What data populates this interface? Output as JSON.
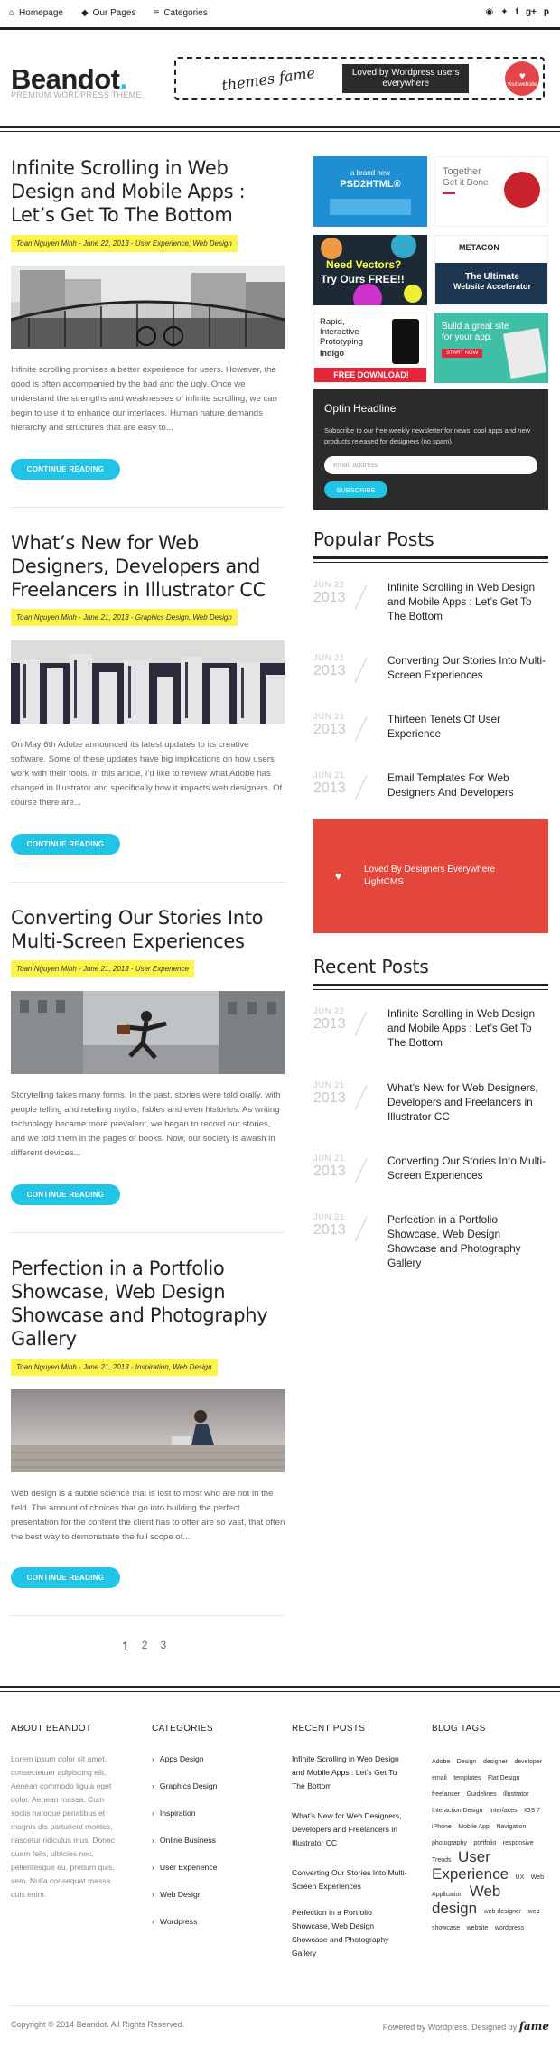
{
  "topnav": {
    "items": [
      {
        "label": "Homepage",
        "icon": "home-icon"
      },
      {
        "label": "Our Pages",
        "icon": "tag-icon"
      },
      {
        "label": "Categories",
        "icon": "menu-icon"
      }
    ],
    "social": [
      "rss-icon",
      "twitter-icon",
      "facebook-icon",
      "google-plus-icon",
      "pinterest-icon"
    ]
  },
  "site": {
    "name": "Beandot",
    "dot": ".",
    "tagline": "PREMIUM WORDPRESS THEME"
  },
  "banner": {
    "script": "themes fame",
    "text": "Loved by Wordpress users everywhere",
    "badge": "visit website"
  },
  "posts": [
    {
      "title": "Infinite Scrolling in Web Design and Mobile Apps : Let’s Get To The Bottom",
      "meta": "Toan Nguyen Minh - June 22, 2013 - User Experience, Web Design",
      "excerpt": "Infinite scrolling promises a better experience for users. However, the good is often accompanied by the bad and the ugly. Once we understand the strengths and weaknesses of infinite scrolling, we can begin to use it to enhance our interfaces. Human nature demands hierarchy and structures that are easy to...",
      "button": "CONTINUE READING"
    },
    {
      "title": "What’s New for Web Designers, Developers and Freelancers in Illustrator CC",
      "meta": "Toan Nguyen Minh - June 21, 2013 - Graphics Design, Web Design",
      "excerpt": "On May 6th Adobe announced its latest updates to its creative software. Some of these updates have big implications on how users work with their tools. In this article, I’d like to review what Adobe has changed in Illustrator and specifically how it impacts web designers. Of course there are...",
      "button": "CONTINUE READING"
    },
    {
      "title": "Converting Our Stories Into Multi-Screen Experiences",
      "meta": "Toan Nguyen Minh - June 21, 2013 - User Experience",
      "excerpt": "Storytelling takes many forms. In the past, stories were told orally, with people telling and retelling myths, fables and even histories. As writing technology became more prevalent, we began to record our stories, and we told them in the pages of books. Now, our society is awash in different devices...",
      "button": "CONTINUE READING"
    },
    {
      "title": "Perfection in a Portfolio Showcase, Web Design Showcase and Photography Gallery",
      "meta": "Toan Nguyen Minh - June 21, 2013 - Inspiration, Web Design",
      "excerpt": "Web design is a subtle science that is lost to most who are not in the field. The amount of choices that go into building the perfect presentation for the content the client has to offer are so vast, that often the best way to demonstrate the full scope of...",
      "button": "CONTINUE READING"
    }
  ],
  "pagination": [
    "1",
    "2",
    "3"
  ],
  "ads": [
    {
      "l1": "a brand new",
      "l2": "PSD2HTML®",
      "l3": ""
    },
    {
      "l1": "Together",
      "l2": "Get it Done",
      "l3": ""
    },
    {
      "l1": "Need Vectors?",
      "l2": "Try Ours FREE!!",
      "l3": ""
    },
    {
      "l1": "METACON",
      "l2": "The Ultimate",
      "l3": "Website Accelerator"
    },
    {
      "l1": "Rapid, Interactive Prototyping",
      "l2": "Indigo",
      "l3": "FREE DOWNLOAD!"
    },
    {
      "l1": "Build a great site",
      "l2": "for your app.",
      "l3": "START NOW"
    }
  ],
  "optin": {
    "title": "Optin Headline",
    "text": "Subscribe to our free weekly newsletter for news, cool apps and new products released for designers (no spam).",
    "placeholder": "email address",
    "button": "SUBSCRIBE"
  },
  "popular": {
    "heading": "Popular Posts",
    "items": [
      {
        "date": "JUN 22",
        "year": "2013",
        "title": "Infinite Scrolling in Web Design and Mobile Apps : Let’s Get To The Bottom"
      },
      {
        "date": "JUN 21",
        "year": "2013",
        "title": "Converting Our Stories Into Multi-Screen Experiences"
      },
      {
        "date": "JUN 21",
        "year": "2013",
        "title": "Thirteen Tenets Of User Experience"
      },
      {
        "date": "JUN 21",
        "year": "2013",
        "title": "Email Templates For Web Designers And Developers"
      }
    ]
  },
  "lightcms": {
    "line1": "Loved By Designers Everywhere",
    "line2": "LightCMS"
  },
  "recent": {
    "heading": "Recent Posts",
    "items": [
      {
        "date": "JUN 22",
        "year": "2013",
        "title": "Infinite Scrolling in Web Design and Mobile Apps : Let’s Get To The Bottom"
      },
      {
        "date": "JUN 21",
        "year": "2013",
        "title": "What’s New for Web Designers, Developers and Freelancers in Illustrator CC"
      },
      {
        "date": "JUN 21",
        "year": "2013",
        "title": "Converting Our Stories Into Multi-Screen Experiences"
      },
      {
        "date": "JUN 21",
        "year": "2013",
        "title": "Perfection in a Portfolio Showcase, Web Design Showcase and Photography Gallery"
      }
    ]
  },
  "footer": {
    "about_heading": "ABOUT BEANDOT",
    "about_text": "Lorem ipsum dolor sit amet, consectetuer adipiscing elit. Aenean commodo ligula eget dolor. Aenean massa. Cum sociis natoque penatibus et magnis dis parturient montes, nascetur ridiculus mus. Donec quam felis, ultricies nec, pellentesque eu, pretium quis, sem. Nulla consequat massa quis enim.",
    "categories_heading": "CATEGORIES",
    "categories": [
      "Apps Design",
      "Graphics Design",
      "Inspiration",
      "Online Business",
      "User Experience",
      "Web Design",
      "Wordpress"
    ],
    "recent_heading": "RECENT POSTS",
    "recent": [
      "Infinite Scrolling in Web Design and Mobile Apps : Let’s Get To The Bottom",
      "What’s New for Web Designers, Developers and Freelancers in Illustrator CC",
      "Converting Our Stories Into Multi-Screen Experiences",
      "Perfection in a Portfolio Showcase, Web Design Showcase and Photography Gallery"
    ],
    "tags_heading": "BLOG TAGS",
    "tags": [
      {
        "t": "Adobe",
        "s": 7
      },
      {
        "t": "Design",
        "s": 7
      },
      {
        "t": "designer",
        "s": 7
      },
      {
        "t": "developer",
        "s": 7
      },
      {
        "t": "email",
        "s": 7
      },
      {
        "t": "templates",
        "s": 7
      },
      {
        "t": "Flat Design",
        "s": 7
      },
      {
        "t": "freelancer",
        "s": 7
      },
      {
        "t": "Guidelines",
        "s": 7
      },
      {
        "t": "illustrator",
        "s": 7
      },
      {
        "t": "Interaction Design",
        "s": 7
      },
      {
        "t": "Interfaces",
        "s": 7
      },
      {
        "t": "IOS 7",
        "s": 7
      },
      {
        "t": "iPhone",
        "s": 7
      },
      {
        "t": "Mobile App",
        "s": 7
      },
      {
        "t": "Navigation",
        "s": 7
      },
      {
        "t": "photography",
        "s": 7
      },
      {
        "t": "portfolio",
        "s": 7
      },
      {
        "t": "responsive",
        "s": 7
      },
      {
        "t": "Trends",
        "s": 7
      },
      {
        "t": "User Experience",
        "s": 17
      },
      {
        "t": "UX",
        "s": 7
      },
      {
        "t": "Web",
        "s": 7
      },
      {
        "t": "Application",
        "s": 7
      },
      {
        "t": "Web design",
        "s": 17
      },
      {
        "t": "web designer",
        "s": 7
      },
      {
        "t": "web showcase",
        "s": 7
      },
      {
        "t": "website",
        "s": 7
      },
      {
        "t": "wordpress",
        "s": 7
      }
    ],
    "copyright": "Copyright © 2014 Beandot. All Rights Reserved.",
    "powered": "Powered by Wordpress. Designed by",
    "designer": "fame"
  }
}
